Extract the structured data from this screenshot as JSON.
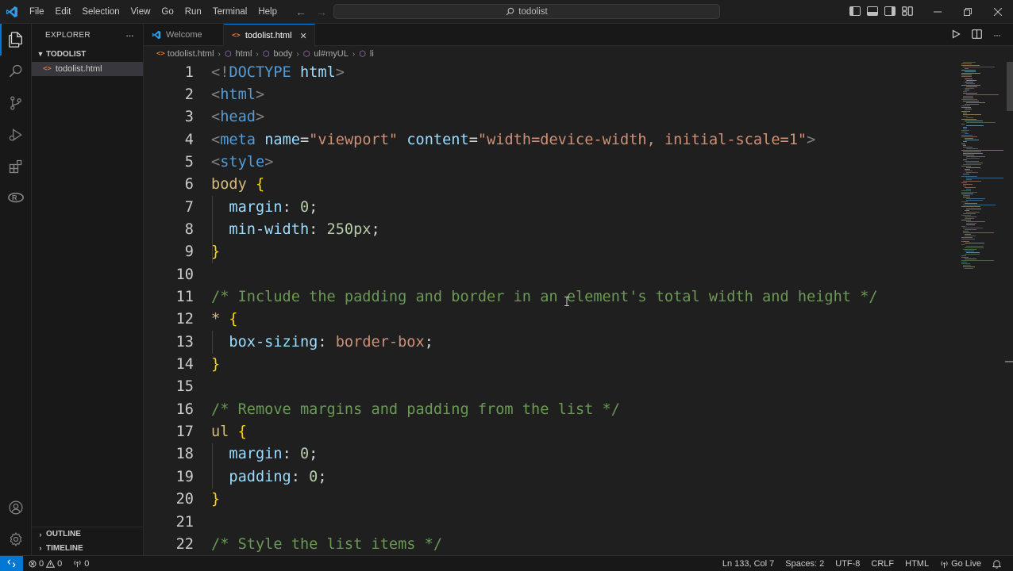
{
  "titlebar": {
    "menu": [
      "File",
      "Edit",
      "Selection",
      "View",
      "Go",
      "Run",
      "Terminal",
      "Help"
    ],
    "search_text": "todolist",
    "colors": {
      "accent": "#0078d4",
      "logo": "#2f9ce6"
    }
  },
  "activitybar": {
    "icons": [
      "explorer-icon",
      "search-icon",
      "source-control-icon",
      "run-debug-icon",
      "extensions-icon",
      "remote-icon",
      "account-icon",
      "settings-gear-icon"
    ]
  },
  "sidebar": {
    "title": "EXPLORER",
    "more": "···",
    "folder": "TODOLIST",
    "file": "todolist.html",
    "outline": "OUTLINE",
    "timeline": "TIMELINE"
  },
  "tabs": {
    "welcome": "Welcome",
    "active": "todolist.html",
    "close": "✕"
  },
  "breadcrumbs": [
    "todolist.html",
    "html",
    "body",
    "ul#myUL",
    "li"
  ],
  "statusbar": {
    "errors": "0",
    "warnings": "0",
    "ports": "0",
    "position": "Ln 133, Col 7",
    "spaces": "Spaces: 2",
    "encoding": "UTF-8",
    "eol": "CRLF",
    "language": "HTML",
    "golive": "Go Live"
  },
  "editor": {
    "lines": [
      {
        "n": "1",
        "tokens": [
          [
            "t-tag",
            "<!"
          ],
          [
            "t-name",
            "DOCTYPE"
          ],
          [
            "t-txt",
            " "
          ],
          [
            "t-attr",
            "html"
          ],
          [
            "t-tag",
            ">"
          ]
        ]
      },
      {
        "n": "2",
        "tokens": [
          [
            "t-tag",
            "<"
          ],
          [
            "t-name",
            "html"
          ],
          [
            "t-tag",
            ">"
          ]
        ]
      },
      {
        "n": "3",
        "tokens": [
          [
            "t-tag",
            "<"
          ],
          [
            "t-name",
            "head"
          ],
          [
            "t-tag",
            ">"
          ]
        ]
      },
      {
        "n": "4",
        "tokens": [
          [
            "t-tag",
            "<"
          ],
          [
            "t-name",
            "meta"
          ],
          [
            "t-txt",
            " "
          ],
          [
            "t-attr",
            "name"
          ],
          [
            "t-txt",
            "="
          ],
          [
            "t-str",
            "\"viewport\""
          ],
          [
            "t-txt",
            " "
          ],
          [
            "t-attr",
            "content"
          ],
          [
            "t-txt",
            "="
          ],
          [
            "t-str",
            "\"width=device-width, initial-scale=1\""
          ],
          [
            "t-tag",
            ">"
          ]
        ]
      },
      {
        "n": "5",
        "tokens": [
          [
            "t-tag",
            "<"
          ],
          [
            "t-name",
            "style"
          ],
          [
            "t-tag",
            ">"
          ]
        ]
      },
      {
        "n": "6",
        "tokens": [
          [
            "t-sel",
            "body"
          ],
          [
            "t-txt",
            " "
          ],
          [
            "t-brace",
            "{"
          ]
        ]
      },
      {
        "n": "7",
        "tokens": [
          [
            "t-txt",
            "  "
          ],
          [
            "t-prop",
            "margin"
          ],
          [
            "t-txt",
            ": "
          ],
          [
            "t-num",
            "0"
          ],
          [
            "t-txt",
            ";"
          ]
        ]
      },
      {
        "n": "8",
        "tokens": [
          [
            "t-txt",
            "  "
          ],
          [
            "t-prop",
            "min-width"
          ],
          [
            "t-txt",
            ": "
          ],
          [
            "t-num",
            "250px"
          ],
          [
            "t-txt",
            ";"
          ]
        ]
      },
      {
        "n": "9",
        "tokens": [
          [
            "t-brace",
            "}"
          ]
        ]
      },
      {
        "n": "10",
        "tokens": []
      },
      {
        "n": "11",
        "tokens": [
          [
            "t-com",
            "/* Include the padding and border in an element's total width and height */"
          ]
        ]
      },
      {
        "n": "12",
        "tokens": [
          [
            "t-sel",
            "*"
          ],
          [
            "t-txt",
            " "
          ],
          [
            "t-brace",
            "{"
          ]
        ]
      },
      {
        "n": "13",
        "tokens": [
          [
            "t-txt",
            "  "
          ],
          [
            "t-prop",
            "box-sizing"
          ],
          [
            "t-txt",
            ": "
          ],
          [
            "t-val",
            "border-box"
          ],
          [
            "t-txt",
            ";"
          ]
        ]
      },
      {
        "n": "14",
        "tokens": [
          [
            "t-brace",
            "}"
          ]
        ]
      },
      {
        "n": "15",
        "tokens": []
      },
      {
        "n": "16",
        "tokens": [
          [
            "t-com",
            "/* Remove margins and padding from the list */"
          ]
        ]
      },
      {
        "n": "17",
        "tokens": [
          [
            "t-sel",
            "ul"
          ],
          [
            "t-txt",
            " "
          ],
          [
            "t-brace",
            "{"
          ]
        ]
      },
      {
        "n": "18",
        "tokens": [
          [
            "t-txt",
            "  "
          ],
          [
            "t-prop",
            "margin"
          ],
          [
            "t-txt",
            ": "
          ],
          [
            "t-num",
            "0"
          ],
          [
            "t-txt",
            ";"
          ]
        ]
      },
      {
        "n": "19",
        "tokens": [
          [
            "t-txt",
            "  "
          ],
          [
            "t-prop",
            "padding"
          ],
          [
            "t-txt",
            ": "
          ],
          [
            "t-num",
            "0"
          ],
          [
            "t-txt",
            ";"
          ]
        ]
      },
      {
        "n": "20",
        "tokens": [
          [
            "t-brace",
            "}"
          ]
        ]
      },
      {
        "n": "21",
        "tokens": []
      },
      {
        "n": "22",
        "tokens": [
          [
            "t-com",
            "/* Style the list items */"
          ]
        ]
      }
    ]
  }
}
